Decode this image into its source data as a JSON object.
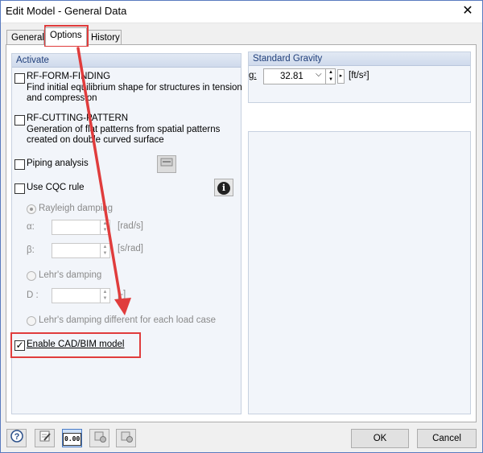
{
  "window": {
    "title": "Edit Model - General Data",
    "close_glyph": "✕"
  },
  "tabs": [
    {
      "label": "General"
    },
    {
      "label": "Options"
    },
    {
      "label": "History"
    }
  ],
  "activate": {
    "title": "Activate",
    "form_finding": {
      "label": "RF-FORM-FINDING",
      "desc_line1": "Find initial equilibrium shape for structures in tension",
      "desc_line2": "and compression",
      "checked": false
    },
    "cutting_pattern": {
      "label": "RF-CUTTING-PATTERN",
      "desc_line1": "Generation of flat patterns from spatial patterns",
      "desc_line2": "created on double curved surface",
      "checked": false
    },
    "piping": {
      "label": "Piping analysis",
      "checked": false
    },
    "cqc": {
      "label": "Use CQC rule",
      "checked": false,
      "info_glyph": "i"
    },
    "rayleigh": {
      "label": "Rayleigh damping",
      "alpha_label": "α:",
      "alpha_unit": "[rad/s]",
      "beta_label": "β:",
      "beta_unit": "[s/rad]"
    },
    "lehr": {
      "label": "Lehr's damping",
      "d_label": "D :",
      "d_unit": "[-]"
    },
    "lehr_each": {
      "label": "Lehr's damping different for each load case"
    },
    "cad_bim": {
      "label": "Enable CAD/BIM model",
      "checked": true,
      "check_glyph": "✓"
    }
  },
  "gravity": {
    "title": "Standard Gravity",
    "g_label": "g:",
    "value": "32.81",
    "unit": "[ft/s²]"
  },
  "footer": {
    "ok_label": "OK",
    "cancel_label": "Cancel",
    "icons": [
      "help-icon",
      "edit-icon",
      "units-icon",
      "import-icon",
      "export-icon"
    ],
    "units_text": "0.00"
  },
  "annotations": {
    "color": "#e03c3c"
  }
}
